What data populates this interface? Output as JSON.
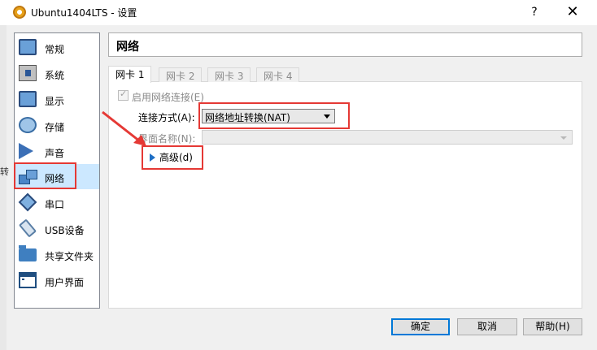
{
  "window": {
    "title": "Ubuntu1404LTS - 设置",
    "help": "?",
    "close": "✕",
    "left_edge_text": "转"
  },
  "sidebar": {
    "items": [
      {
        "label": "常规",
        "icon": "screen-icon"
      },
      {
        "label": "系统",
        "icon": "chip-icon"
      },
      {
        "label": "显示",
        "icon": "monitor-icon"
      },
      {
        "label": "存储",
        "icon": "disk-icon"
      },
      {
        "label": "声音",
        "icon": "speaker-icon"
      },
      {
        "label": "网络",
        "icon": "network-icon",
        "selected": true
      },
      {
        "label": "串口",
        "icon": "serial-port-icon"
      },
      {
        "label": "USB设备",
        "icon": "usb-icon"
      },
      {
        "label": "共享文件夹",
        "icon": "folder-icon"
      },
      {
        "label": "用户界面",
        "icon": "ui-icon"
      }
    ]
  },
  "page_title": "网络",
  "tabs": [
    "网卡 1",
    "网卡 2",
    "网卡 3",
    "网卡 4"
  ],
  "adapter": {
    "enable_label": "启用网络连接(E)",
    "enabled": true,
    "attached_label": "连接方式(A):",
    "attached_value": "网络地址转换(NAT)",
    "name_label": "界面名称(N):",
    "name_value": "",
    "advanced_label": "高级(d)"
  },
  "buttons": {
    "ok": "确定",
    "cancel": "取消",
    "help": "帮助(H)"
  },
  "colors": {
    "annotation": "#e53935",
    "selected_bg": "#cce8ff",
    "accent": "#0078d7"
  }
}
